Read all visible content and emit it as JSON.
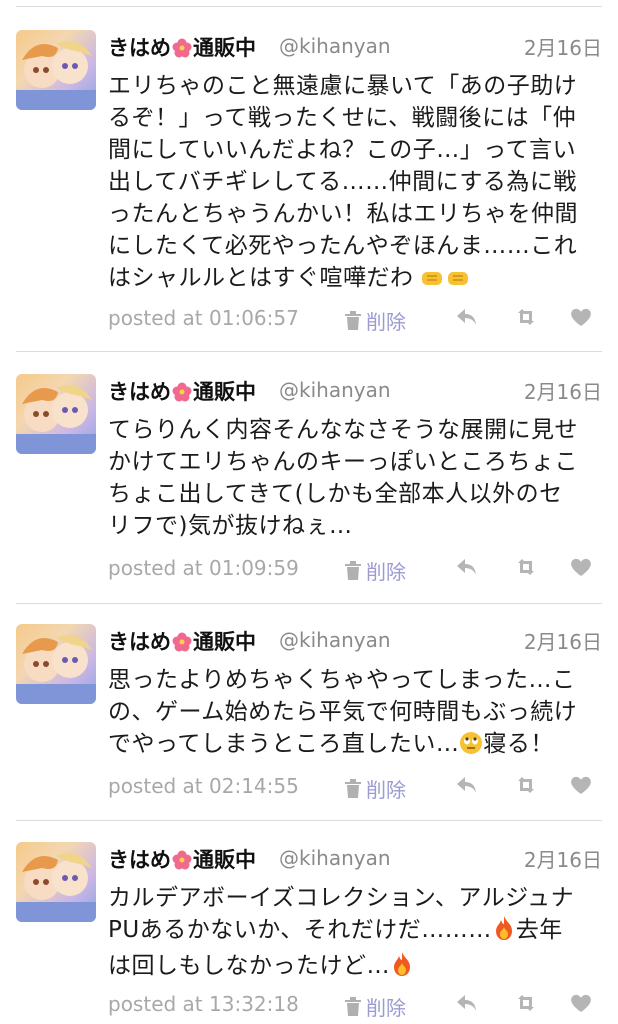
{
  "tweets": [
    {
      "name": "きはめ",
      "name_suffix": "通販中",
      "handle": "@kihanyan",
      "date": "2月16日",
      "text": "エリちゃのこと無遠慮に暴いて「あの子助け\nるぞ！」って戦ったくせに、戦闘後には「仲\n間にしていいんだよね？この子…」って言い\n出してバチギレしてる……仲間にする為に戦\nったんとちゃうんかい！私はエリちゃを仲間\nにしたくて必死やったんやぞほんま……これ\nはシャルルとはすぐ喧嘩だわ",
      "posted": "posted at 01:06:57",
      "delete_label": "削除"
    },
    {
      "name": "きはめ",
      "name_suffix": "通販中",
      "handle": "@kihanyan",
      "date": "2月16日",
      "text": "てらりんく内容そんななさそうな展開に見せ\nかけてエリちゃんのキーっぽいところちょこ\nちょこ出してきて(しかも全部本人以外のセ\nリフで)気が抜けねぇ…",
      "posted": "posted at 01:09:59",
      "delete_label": "削除"
    },
    {
      "name": "きはめ",
      "name_suffix": "通販中",
      "handle": "@kihanyan",
      "date": "2月16日",
      "text_a": "思ったよりめちゃくちゃやってしまった…こ\nの、ゲーム始めたら平気で何時間もぶっ続け\nでやってしまうところ直したい…",
      "text_b": "寝る！",
      "posted": "posted at 02:14:55",
      "delete_label": "削除"
    },
    {
      "name": "きはめ",
      "name_suffix": "通販中",
      "handle": "@kihanyan",
      "date": "2月16日",
      "text_a": "カルデアボーイズコレクション、アルジュナ\nPUあるかないか、それだけだ………",
      "text_b": "去年\nは回しもしなかったけど…",
      "posted": "posted at 13:32:18",
      "delete_label": "削除"
    }
  ],
  "icons": [
    "hibiscus-icon",
    "trash-icon",
    "reply-icon",
    "retweet-icon",
    "heart-icon",
    "fist-bump-emoji",
    "rolling-eyes-emoji",
    "fire-emoji"
  ],
  "colors": {
    "delete": "#9b9bd2",
    "meta": "#a8a8a8",
    "handle": "#8a8a8a",
    "divider": "#dcdcdc"
  }
}
